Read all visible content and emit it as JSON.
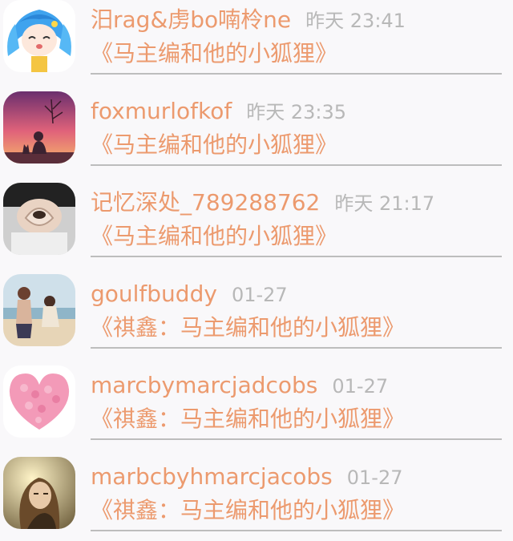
{
  "messages": [
    {
      "name": "汨rag&虏bo喃柃ne",
      "time": "昨天 23:41",
      "book": "《马主编和他的小狐狸》",
      "avatar_icon": "anime-blue-hair-avatar-icon"
    },
    {
      "name": "foxmurlofkof",
      "time": "昨天 23:35",
      "book": "《马主编和他的小狐狸》",
      "avatar_icon": "sunset-cat-avatar-icon"
    },
    {
      "name": "记忆深处_789288762",
      "time": "昨天 21:17",
      "book": "《马主编和他的小狐狸》",
      "avatar_icon": "hand-heart-avatar-icon"
    },
    {
      "name": "goulfbuddy",
      "time": "01-27",
      "book": "《祺鑫：马主编和他的小狐狸》",
      "avatar_icon": "beach-couple-avatar-icon"
    },
    {
      "name": "marcbymarcjadcobs",
      "time": "01-27",
      "book": "《祺鑫：马主编和他的小狐狸》",
      "avatar_icon": "pink-rose-heart-avatar-icon"
    },
    {
      "name": "marbcbyhmarcjacobs",
      "time": "01-27",
      "book": "《祺鑫：马主编和他的小狐狸》",
      "avatar_icon": "girl-portrait-avatar-icon"
    }
  ],
  "colors": {
    "name_text": "#ec9a6e",
    "time_text": "#b8b8b8",
    "divider": "#bdbdbd",
    "background": "#f9f8fa"
  }
}
